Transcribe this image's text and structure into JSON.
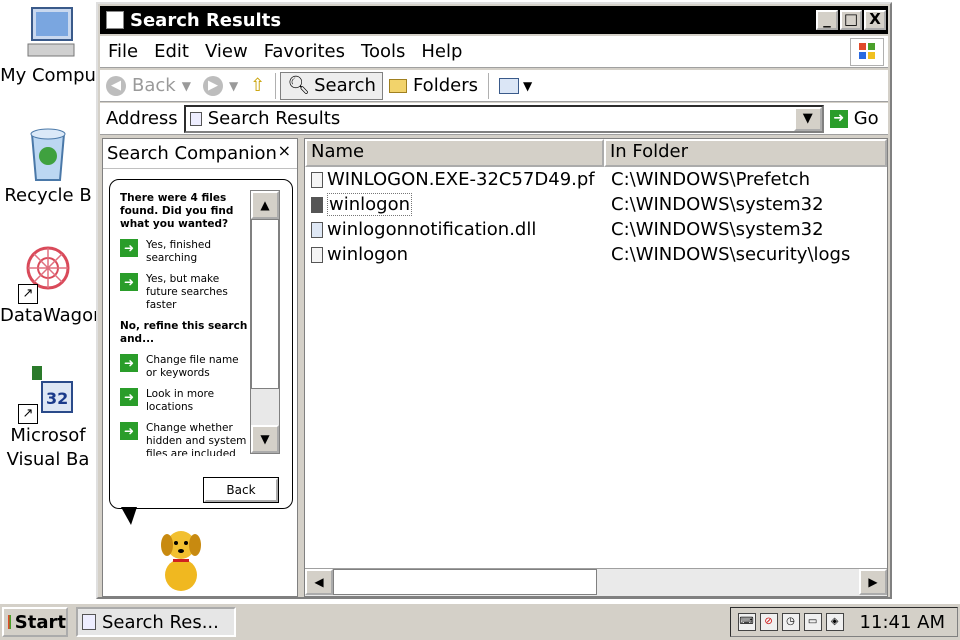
{
  "desktop": {
    "icons": [
      {
        "label": "My Compu"
      },
      {
        "label": "Recycle B"
      },
      {
        "label": "DataWagon"
      },
      {
        "label": "Microsof",
        "label2": "Visual Ba"
      }
    ]
  },
  "window": {
    "title": "Search Results",
    "controls": {
      "minimize": "_",
      "maximize": "□",
      "close": "X"
    }
  },
  "menu": {
    "items": [
      "File",
      "Edit",
      "View",
      "Favorites",
      "Tools",
      "Help"
    ]
  },
  "toolbar": {
    "back": "Back",
    "search": "Search",
    "folders": "Folders"
  },
  "address": {
    "label": "Address",
    "value": "Search Results",
    "go": "Go"
  },
  "companion": {
    "title": "Search Companion",
    "close": "×",
    "summary": "There were 4 files found. Did you find what you wanted?",
    "yes_options": [
      "Yes, finished searching",
      "Yes, but make future searches faster"
    ],
    "refine_heading": "No, refine this search and...",
    "refine_options": [
      "Change file name or keywords",
      "Look in more locations",
      "Change whether hidden and system files are included"
    ],
    "back_button": "Back"
  },
  "results": {
    "columns": [
      "Name",
      "In Folder"
    ],
    "rows": [
      {
        "name": "WINLOGON.EXE-32C57D49.pf",
        "folder": "C:\\WINDOWS\\Prefetch"
      },
      {
        "name": "winlogon",
        "folder": "C:\\WINDOWS\\system32"
      },
      {
        "name": "winlogonnotification.dll",
        "folder": "C:\\WINDOWS\\system32"
      },
      {
        "name": "winlogon",
        "folder": "C:\\WINDOWS\\security\\logs"
      }
    ]
  },
  "taskbar": {
    "start": "Start",
    "task": "Search Res...",
    "clock": "11:41 AM"
  },
  "colors": {
    "titlebar": "#000000",
    "chrome": "#d4d0c8",
    "accent_green": "#2a9d2a"
  }
}
